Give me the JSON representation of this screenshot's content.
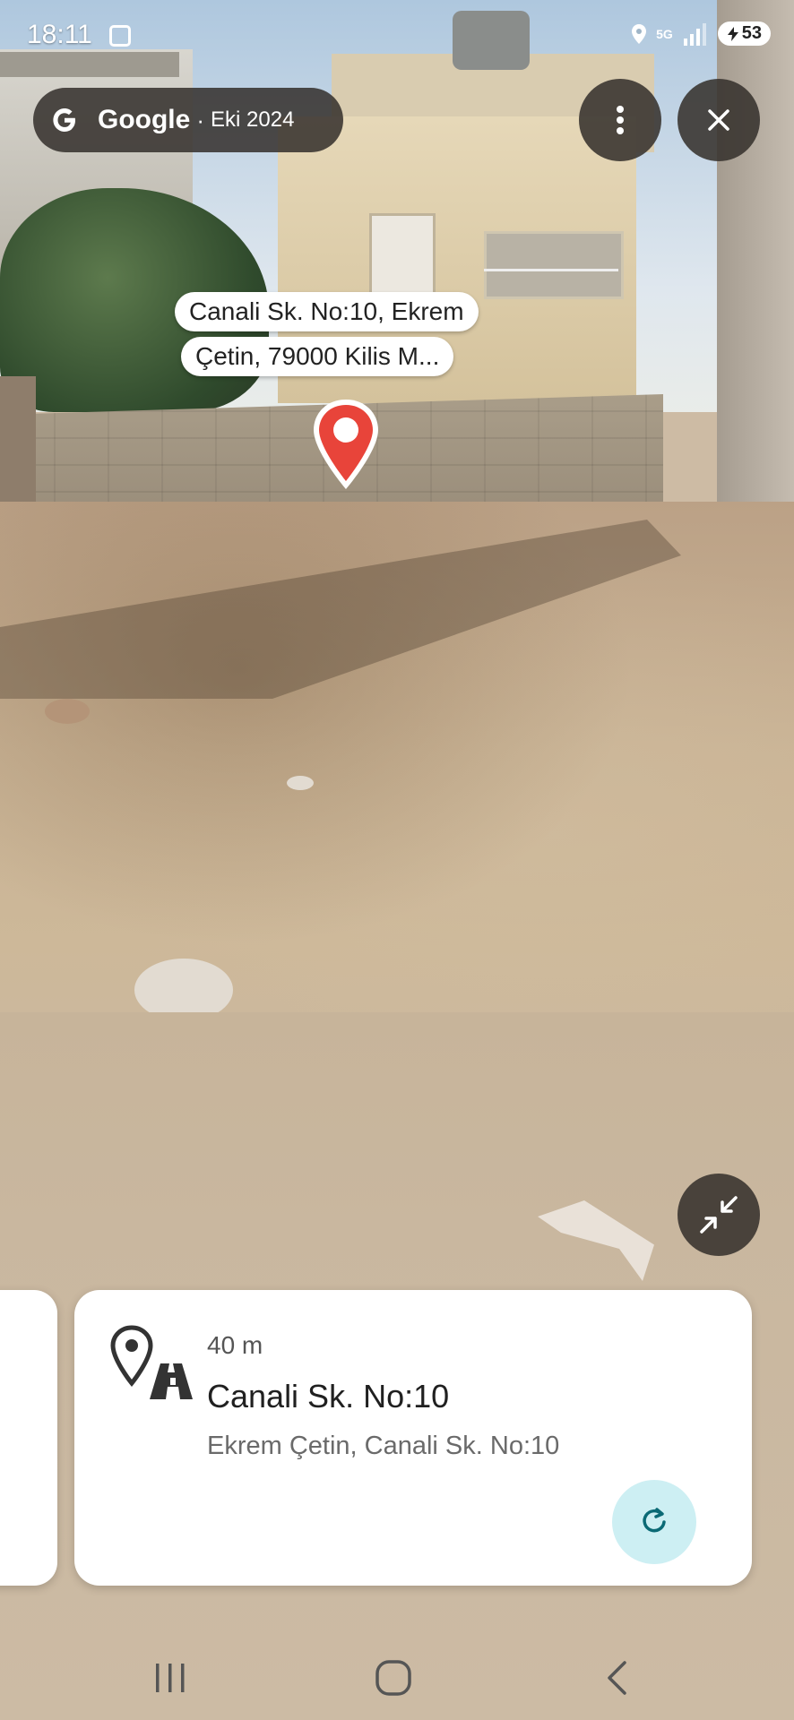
{
  "status_bar": {
    "time": "18:11",
    "network": "5G",
    "battery": "53"
  },
  "header": {
    "brand": "Google",
    "separator": "·",
    "date": "Eki 2024"
  },
  "map_label": {
    "line1": "Canali Sk. No:10, Ekrem",
    "line2": "Çetin, 79000 Kilis M..."
  },
  "place_card": {
    "distance": "40 m",
    "title": "Canali Sk. No:10",
    "subtitle": "Ekrem Çetin, Canali Sk. No:10"
  },
  "icons": {
    "more": "more-vert-icon",
    "close": "close-icon",
    "collapse": "collapse-icon",
    "refresh": "refresh-icon",
    "place": "location-road-icon"
  },
  "colors": {
    "pin_red": "#e8443a",
    "refresh_bg": "#cdeff3",
    "refresh_icon": "#0b6a75",
    "overlay_dark": "#37322e"
  }
}
